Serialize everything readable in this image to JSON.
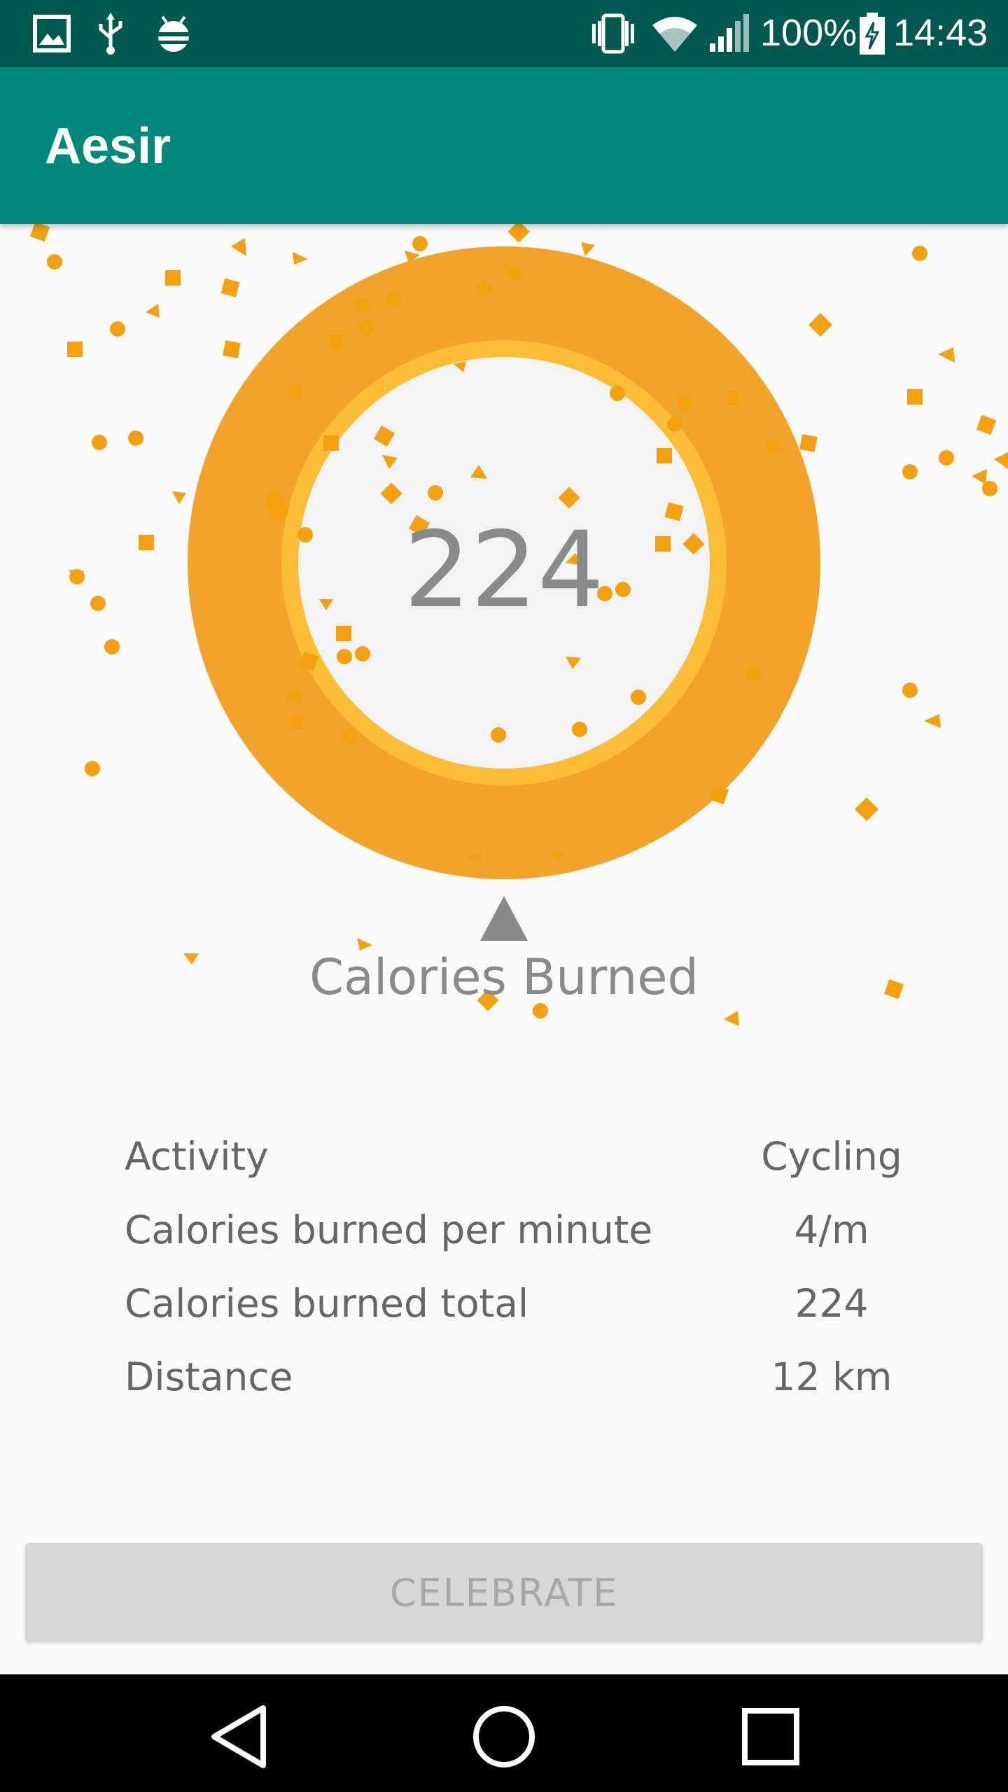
{
  "status_bar": {
    "battery": "100%",
    "time": "14:43",
    "icons": [
      "gallery-icon",
      "usb-icon",
      "android-debug-icon",
      "vibrate-icon",
      "wifi-icon",
      "signal-icon",
      "battery-charging-icon"
    ]
  },
  "app_bar": {
    "title": "Aesir"
  },
  "gauge": {
    "value": "224",
    "label": "Calories Burned",
    "outer_color": "#f2a32a",
    "inner_color": "#fbbd35",
    "face_color": "#f3f3f3"
  },
  "stats": [
    {
      "label": "Activity",
      "value": "Cycling"
    },
    {
      "label": "Calories burned per minute",
      "value": "4/m"
    },
    {
      "label": "Calories burned total",
      "value": "224"
    },
    {
      "label": "Distance",
      "value": "12 km"
    }
  ],
  "actions": {
    "celebrate_label": "CELEBRATE"
  },
  "colors": {
    "status_bar": "#00594f",
    "app_bar": "#00897b",
    "confetti": "#f5a00f"
  },
  "nav": {
    "buttons": [
      "back-icon",
      "home-icon",
      "recents-icon"
    ]
  }
}
